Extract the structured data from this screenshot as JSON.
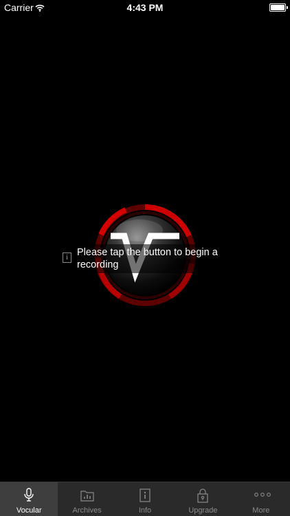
{
  "status_bar": {
    "carrier": "Carrier",
    "time": "4:43 PM"
  },
  "tooltip": {
    "icon": "info-icon",
    "message": "Please tap the button to begin a recording"
  },
  "record_button": {
    "logo_letter": "V",
    "ring_color": "#b30000",
    "icon": "vocular-logo"
  },
  "tabs": [
    {
      "label": "Vocular",
      "icon": "microphone-icon",
      "active": true
    },
    {
      "label": "Archives",
      "icon": "folder-chart-icon",
      "active": false
    },
    {
      "label": "Info",
      "icon": "info-icon",
      "active": false
    },
    {
      "label": "Upgrade",
      "icon": "lock-icon",
      "active": false
    },
    {
      "label": "More",
      "icon": "more-dots-icon",
      "active": false
    }
  ]
}
